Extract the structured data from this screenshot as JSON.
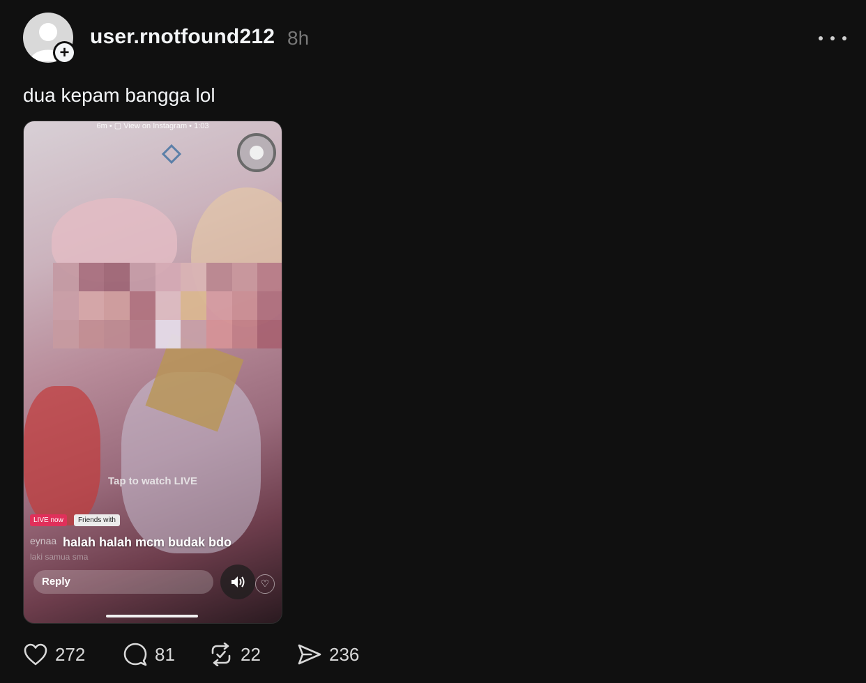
{
  "post": {
    "username": "user.rnotfound212",
    "time": "8h",
    "caption": "dua kepam bangga lol"
  },
  "media": {
    "top_bar": "6m • ▢ View on Instagram • 1:03",
    "tap_to_watch": "Tap to watch LIVE",
    "live_badge": "LIVE now",
    "friends_badge": "Friends with",
    "comment_user": "eynaa",
    "comment_text": "halah halah mcm budak bdo",
    "comment_sub": "laki samua sma",
    "reply_placeholder": "Reply"
  },
  "actions": {
    "likes": "272",
    "comments": "81",
    "reposts": "22",
    "shares": "236"
  },
  "colors": {
    "background": "#101010",
    "text_primary": "#f3f5f7",
    "text_muted": "#777777",
    "live_badge": "#e0305a"
  },
  "icons": [
    "avatar-placeholder",
    "follow-plus-icon",
    "more-options-icon",
    "sound-icon",
    "heart-icon",
    "comment-icon",
    "repost-icon",
    "share-icon"
  ]
}
